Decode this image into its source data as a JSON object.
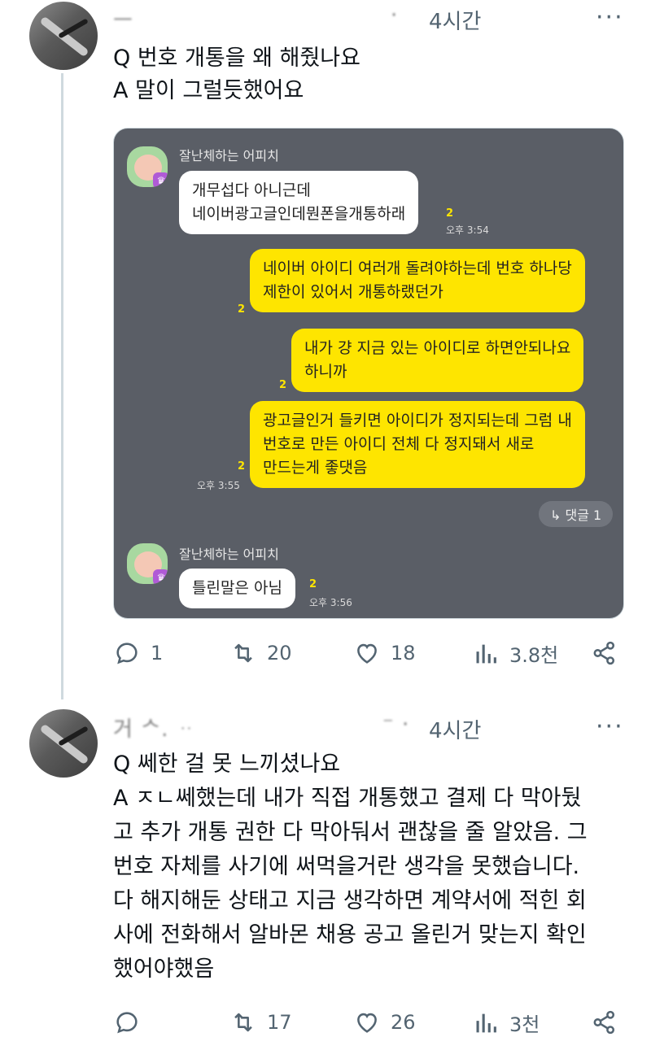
{
  "tweet1": {
    "author_name": "ᅳ",
    "author_handle": "·",
    "time": "4시간",
    "more": "···",
    "lines": [
      "Q 번호 개통을 왜 해줬나요",
      "A 말이 그럴듯했어요"
    ],
    "chat": {
      "sender": "잘난체하는 어피치",
      "messages": [
        {
          "text": "개무섭다 아니근데\n네이버광고글인데뭔폰을개통하래",
          "unread": "2",
          "time": "오후 3:54"
        },
        {
          "text": "네이버 아이디 여러개 돌려야하는데 번호 하나당\n제한이 있어서 개통하랬던가",
          "unread": "2"
        },
        {
          "text": "내가 걍 지금 있는 아이디로 하면안되나요\n하니까",
          "unread": "2"
        },
        {
          "text": "광고글인거 들키면 아이디가 정지되는데 그럼 내\n번호로 만든 아이디 전체 다 정지돼서 새로\n만드는게 좋댓음",
          "unread": "2",
          "time": "오후 3:55"
        },
        {
          "text": "틀린말은 아님",
          "unread": "2",
          "time": "오후 3:56"
        }
      ],
      "reply_label": "↳ 댓글 1",
      "sender2": "잘난체하는 어피치"
    },
    "actions": {
      "replies": "1",
      "retweets": "20",
      "likes": "18",
      "views": "3.8천"
    }
  },
  "tweet2": {
    "author_name": "거 ᄉ. ᆢ",
    "author_handle": "⁻ ·",
    "time": "4시간",
    "more": "···",
    "lines": [
      "Q 쎄한 걸 못 느끼셨나요",
      "A ㅈㄴ쎄했는데 내가 직접 개통했고 결제 다 막아뒀",
      "고 추가 개통 권한 다 막아둬서 괜찮을 줄 알았음. 그",
      "번호 자체를 사기에 써먹을거란 생각을 못했습니다.",
      "다 해지해둔 상태고 지금 생각하면 계약서에 적힌 회",
      "사에 전화해서 알바몬 채용 공고 올린거 맞는지 확인",
      "했어야했음"
    ],
    "actions": {
      "replies": "",
      "retweets": "17",
      "likes": "26",
      "views": "3천"
    }
  },
  "colors": {
    "text": "#0f1419",
    "muted": "#536471",
    "kakao_yellow": "#fee500",
    "chat_bg": "#5a5e66"
  },
  "icons": {
    "reply": "reply-icon",
    "retweet": "retweet-icon",
    "like": "heart-icon",
    "views": "views-icon",
    "share": "share-icon"
  }
}
